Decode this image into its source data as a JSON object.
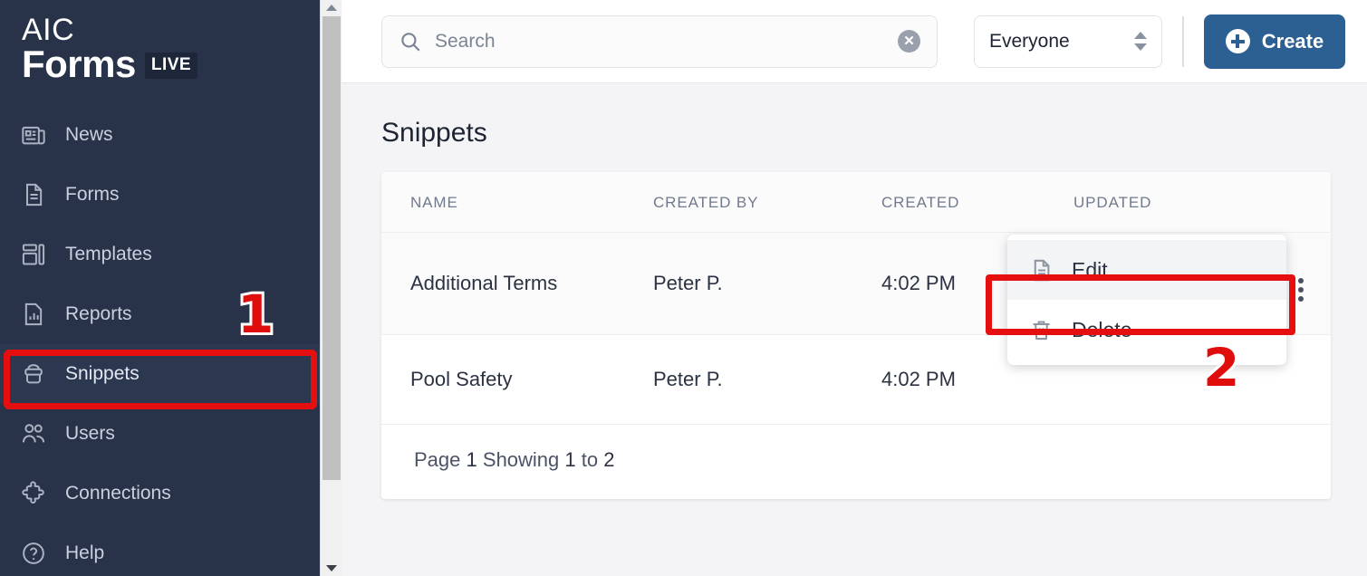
{
  "brand": {
    "line1": "AIC",
    "line2": "Forms",
    "badge": "LIVE"
  },
  "sidebar": {
    "items": [
      {
        "label": "News",
        "icon": "newspaper-icon",
        "active": false
      },
      {
        "label": "Forms",
        "icon": "document-icon",
        "active": false
      },
      {
        "label": "Templates",
        "icon": "layout-icon",
        "active": false
      },
      {
        "label": "Reports",
        "icon": "chart-file-icon",
        "active": false
      },
      {
        "label": "Snippets",
        "icon": "snippet-icon",
        "active": true
      },
      {
        "label": "Users",
        "icon": "users-icon",
        "active": false
      },
      {
        "label": "Connections",
        "icon": "puzzle-icon",
        "active": false
      },
      {
        "label": "Help",
        "icon": "question-icon",
        "active": false
      }
    ]
  },
  "topbar": {
    "search": {
      "placeholder": "Search",
      "value": "",
      "icon": "search-icon",
      "clear_icon": "clear-circle-icon"
    },
    "audience_select": {
      "value": "Everyone",
      "icon": "stepper-chevrons-icon"
    },
    "create_button": {
      "label": "Create",
      "icon": "plus-circle-icon",
      "color": "#2c5f92"
    }
  },
  "main": {
    "title": "Snippets",
    "table": {
      "columns": [
        "NAME",
        "CREATED BY",
        "CREATED",
        "UPDATED"
      ],
      "rows": [
        {
          "name": "Additional Terms",
          "created_by": "Peter P.",
          "created": "4:02 PM",
          "updated": ""
        },
        {
          "name": "Pool Safety",
          "created_by": "Peter P.",
          "created": "4:02 PM",
          "updated": ""
        }
      ]
    },
    "pagination": {
      "page_label": "Page",
      "page_number": "1",
      "showing_label": "Showing",
      "from": "1",
      "to_label": "to",
      "to": "2"
    }
  },
  "context_menu": {
    "items": [
      {
        "label": "Edit",
        "icon": "document-edit-icon",
        "highlighted": true
      },
      {
        "label": "Delete",
        "icon": "trash-icon",
        "highlighted": false
      }
    ]
  },
  "annotations": {
    "color": "#e00d0d",
    "markers": [
      {
        "number": "1",
        "target": "sidebar-item-snippets"
      },
      {
        "number": "2",
        "target": "context-menu-item-edit"
      }
    ]
  }
}
